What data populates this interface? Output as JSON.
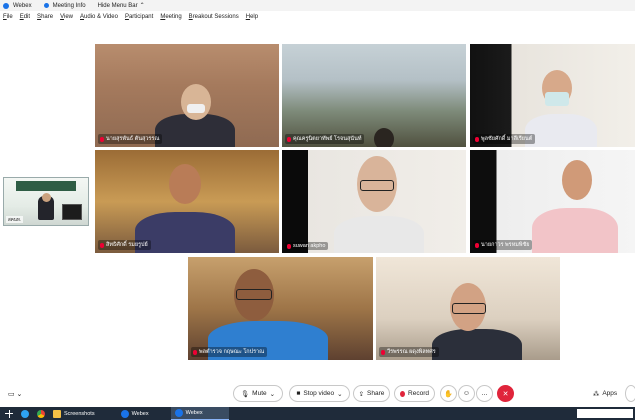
{
  "titlebar": {
    "app_name": "Webex",
    "meeting_info": "Meeting Info",
    "hide_menu": "Hide Menu Bar"
  },
  "menubar": [
    "File",
    "Edit",
    "Share",
    "View",
    "Audio & Video",
    "Participant",
    "Meeting",
    "Breakout Sessions",
    "Help"
  ],
  "participants": [
    {
      "name": "นายสุรพันธ์ ตันสุวรรณ"
    },
    {
      "name": "คุณครูนิตยาทัพย์ โรจนสุนันท์"
    },
    {
      "name": "พูลชัยศักดิ์ มาลีเรียนต์"
    },
    {
      "name": "สิทธิศักดิ์ รมยรูปย์"
    },
    {
      "name": "suwan akpho"
    },
    {
      "name": "นายกาวร พรหมพิชัย"
    },
    {
      "name": "พลตํารวจ กฤษณะ โกปราณ"
    },
    {
      "name": "วีรพรรณ ผดุงพิลทศร"
    }
  ],
  "self_view": {
    "label": "สคนท.",
    "sign_text": "สำนักงานคณะกรรมการนโยบายที่ดินแห่งชาติ"
  },
  "controls": {
    "mute": "Mute",
    "stop_video": "Stop video",
    "share": "Share",
    "record": "Record",
    "apps": "Apps",
    "more": "...",
    "end": "✕"
  },
  "taskbar": {
    "screenshots": "Screenshots",
    "webex1": "Webex",
    "webex2": "Webex"
  },
  "colors": {
    "end_button": "#e0243b",
    "webex_blue": "#1a73e8",
    "taskbar": "#1f2b3a"
  }
}
